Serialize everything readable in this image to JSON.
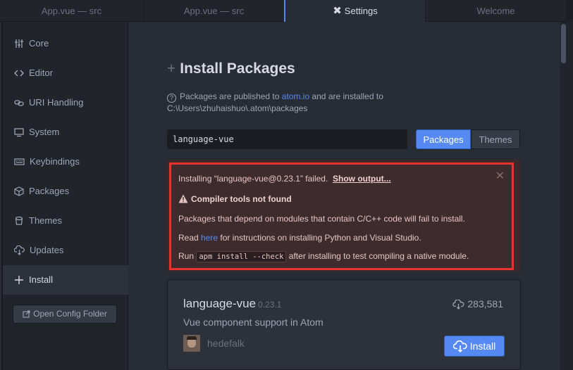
{
  "tabs": [
    {
      "label": "App.vue — src"
    },
    {
      "label": "App.vue — src"
    },
    {
      "label": "Settings",
      "icon": "tools-icon"
    },
    {
      "label": "Welcome"
    }
  ],
  "sidebar": {
    "items": [
      {
        "label": "Core",
        "icon": "sliders-icon"
      },
      {
        "label": "Editor",
        "icon": "code-icon"
      },
      {
        "label": "URI Handling",
        "icon": "link-icon"
      },
      {
        "label": "System",
        "icon": "monitor-icon"
      },
      {
        "label": "Keybindings",
        "icon": "keyboard-icon"
      },
      {
        "label": "Packages",
        "icon": "package-icon"
      },
      {
        "label": "Themes",
        "icon": "paintcan-icon"
      },
      {
        "label": "Updates",
        "icon": "cloud-download-icon"
      },
      {
        "label": "Install",
        "icon": "plus-icon",
        "active": true
      }
    ],
    "open_config_label": "Open Config Folder"
  },
  "install": {
    "title": "Install Packages",
    "info_prefix": "Packages are published to ",
    "info_link": "atom.io",
    "info_suffix": " and are installed to",
    "info_path": "C:\\Users\\zhuhaishuo\\.atom\\packages",
    "search_value": "language-vue",
    "packages_label": "Packages",
    "themes_label": "Themes"
  },
  "alert": {
    "line1_text": "Installing “language-vue@0.23.1” failed.",
    "line1_link": "Show output...",
    "heading": "Compiler tools not found",
    "line3": "Packages that depend on modules that contain C/C++ code will fail to install.",
    "line4_prefix": "Read ",
    "line4_link": "here",
    "line4_suffix": " for instructions on installing Python and Visual Studio.",
    "line5_prefix": "Run ",
    "line5_code": "apm install --check",
    "line5_suffix": " after installing to test compiling a native module."
  },
  "package": {
    "name": "language-vue",
    "version": "0.23.1",
    "downloads": "283,581",
    "description": "Vue component support in Atom",
    "author": "hedefalk",
    "install_label": "Install"
  },
  "colors": {
    "accent": "#568af2",
    "error_border": "#e8322d"
  }
}
